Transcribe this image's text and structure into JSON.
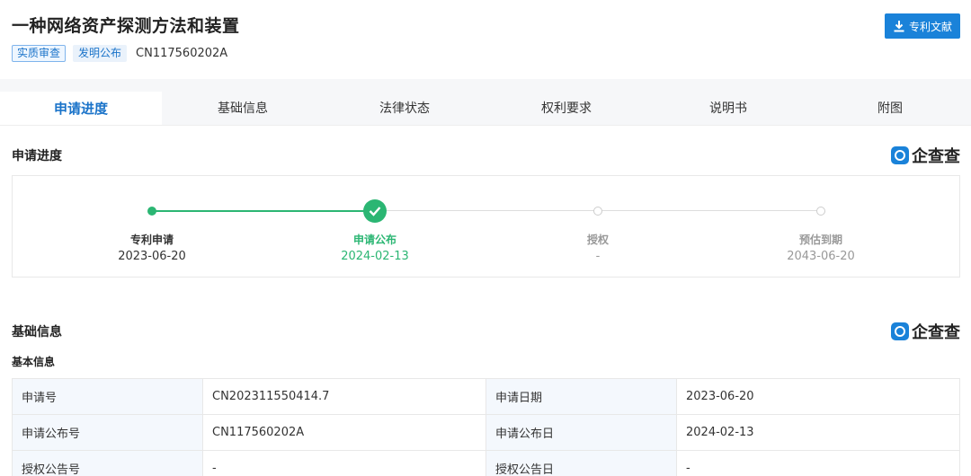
{
  "header": {
    "title": "一种网络资产探测方法和装置",
    "tags": [
      "实质审查",
      "发明公布"
    ],
    "publication_number": "CN117560202A",
    "download_button_label": "专利文献",
    "download_icon": "download-icon"
  },
  "tabs": [
    {
      "label": "申请进度",
      "active": true
    },
    {
      "label": "基础信息",
      "active": false
    },
    {
      "label": "法律状态",
      "active": false
    },
    {
      "label": "权利要求",
      "active": false
    },
    {
      "label": "说明书",
      "active": false
    },
    {
      "label": "附图",
      "active": false
    }
  ],
  "brand": {
    "name": "企查查",
    "logo": "qichacha-logo-icon"
  },
  "progress": {
    "title": "申请进度",
    "steps": [
      {
        "label": "专利申请",
        "date": "2023-06-20",
        "state": "done"
      },
      {
        "label": "申请公布",
        "date": "2024-02-13",
        "state": "current"
      },
      {
        "label": "授权",
        "date": "-",
        "state": "pending"
      },
      {
        "label": "预估到期",
        "date": "2043-06-20",
        "state": "pending"
      }
    ]
  },
  "basic": {
    "title": "基础信息",
    "subtitle": "基本信息",
    "rows": [
      [
        {
          "k": "申请号",
          "v": "CN202311550414.7"
        },
        {
          "k": "申请日期",
          "v": "2023-06-20"
        }
      ],
      [
        {
          "k": "申请公布号",
          "v": "CN117560202A"
        },
        {
          "k": "申请公布日",
          "v": "2024-02-13"
        }
      ],
      [
        {
          "k": "授权公告号",
          "v": "-"
        },
        {
          "k": "授权公告日",
          "v": "-"
        }
      ]
    ]
  },
  "colors": {
    "accent": "#1a82d9",
    "green": "#2bb673",
    "muted": "#999999",
    "line_gray": "#dddddd"
  }
}
